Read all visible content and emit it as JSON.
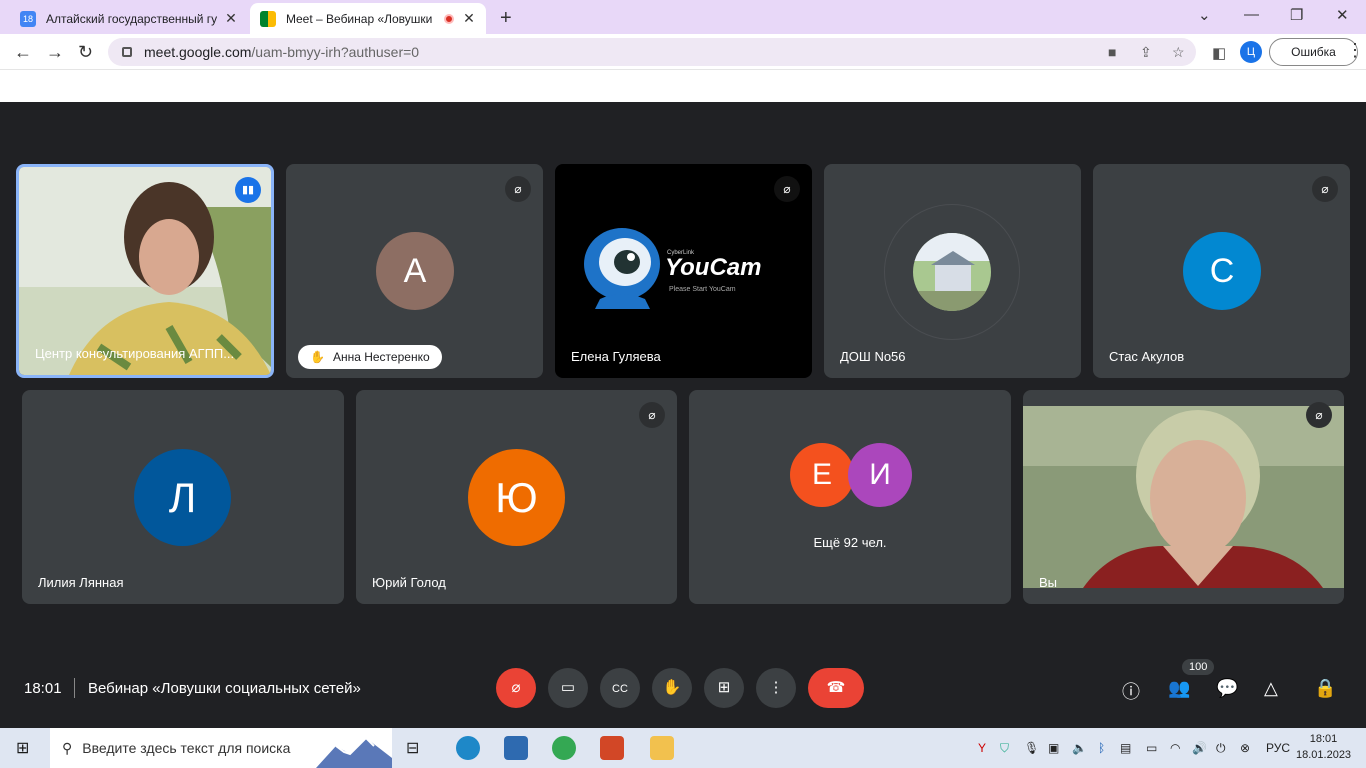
{
  "browser": {
    "tabs": [
      {
        "title": "Алтайский государственный гу",
        "close": "✕"
      },
      {
        "title": "Meet – Вебинар «Ловушки",
        "close": "✕"
      }
    ],
    "new_tab": "+",
    "url_host": "meet.google.com",
    "url_path": "/uam-bmyy-irh?authuser=0",
    "profile_letter": "Ц",
    "error_label": "Ошибка"
  },
  "participants": [
    {
      "name": "Центр консультирования АГПП...",
      "avatar": "",
      "color": ""
    },
    {
      "name": "Анна Нестеренко",
      "avatar": "А",
      "color": "#8d6e63"
    },
    {
      "name": "Елена Гуляева",
      "avatar": "",
      "color": ""
    },
    {
      "name": "ДОШ No56",
      "avatar": "",
      "color": ""
    },
    {
      "name": "Стас Акулов",
      "avatar": "С",
      "color": "#0288d1"
    },
    {
      "name": "Лилия Лянная",
      "avatar": "Л",
      "color": "#01579b"
    },
    {
      "name": "Юрий Голод",
      "avatar": "Ю",
      "color": "#ef6c00"
    },
    {
      "name": "Вы",
      "avatar": "",
      "color": ""
    }
  ],
  "more_tile": {
    "avatars": [
      "Е",
      "И"
    ],
    "text": "Ещё 92 чел."
  },
  "youcam": {
    "brand_small": "CyberLink",
    "brand": "YouCam",
    "sub": "Please Start YouCam"
  },
  "meeting": {
    "time": "18:01",
    "title": "Вебинар «Ловушки социальных сетей»",
    "people_count": "100"
  },
  "taskbar": {
    "search_placeholder": "Введите здесь текст для поиска",
    "lang": "РУС",
    "time": "18:01",
    "date": "18.01.2023"
  },
  "colors": {
    "accent": "#1a73e8",
    "danger": "#ea4335",
    "tile": "#3c4043",
    "bg": "#202124"
  }
}
